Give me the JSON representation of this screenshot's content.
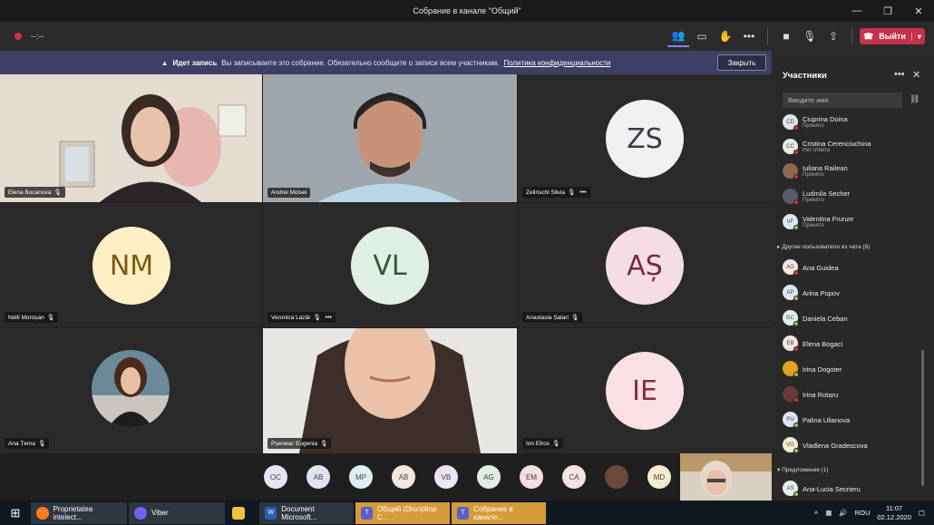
{
  "window": {
    "title": "Собрание в канале \"Общий\""
  },
  "toolbar": {
    "timer": "--:--",
    "leave_label": "Выйти"
  },
  "notice": {
    "title": "Идет запись",
    "text": "Вы записываете это собрание. Обязательно сообщите о записи всем участникам.",
    "link": "Политика конфиденциальности",
    "close_label": "Закрыть"
  },
  "tiles": [
    {
      "name": "Elena Bocancea",
      "type": "video"
    },
    {
      "name": "Andrei Moisei",
      "type": "video"
    },
    {
      "name": "Zelinschi Silvia",
      "type": "avatar",
      "initials": "ZS",
      "color": "#f2eff0",
      "text_color": "#3a3a4a"
    },
    {
      "name": "Nelli Moroșan",
      "type": "avatar",
      "initials": "NM",
      "color": "#fdf0c4",
      "text_color": "#7a5a10"
    },
    {
      "name": "Veronica Lazăr",
      "type": "avatar",
      "initials": "VL",
      "color": "#e0efe3",
      "text_color": "#2d5a36"
    },
    {
      "name": "Anastasia Șalari",
      "type": "avatar",
      "initials": "AȘ",
      "color": "#f5dde6",
      "text_color": "#7a2a40"
    },
    {
      "name": "Ana Țema",
      "type": "photo"
    },
    {
      "name": "Pșeneac Eugenia",
      "type": "video"
    },
    {
      "name": "Ion Efros",
      "type": "avatar",
      "initials": "IE",
      "color": "#f9e0e4",
      "text_color": "#8a2a38"
    }
  ],
  "strip": [
    {
      "initials": "OC",
      "color": "#e6e4f4"
    },
    {
      "initials": "AB",
      "color": "#dfe3ee"
    },
    {
      "initials": "MP",
      "color": "#dceff3"
    },
    {
      "initials": "AB",
      "color": "#f3e7de"
    },
    {
      "initials": "VB",
      "color": "#ece4f2"
    },
    {
      "initials": "AG",
      "color": "#e0ede3"
    },
    {
      "initials": "EM",
      "color": "#f4dede"
    },
    {
      "initials": "CA",
      "color": "#f4e3e0"
    },
    {
      "initials": "",
      "color": "#6a4a3a"
    },
    {
      "initials": "MD",
      "color": "#f7ead2"
    }
  ],
  "panel": {
    "title": "Участники",
    "search_placeholder": "Введите имя",
    "members": [
      {
        "initials": "CD",
        "name": "Ciuprina Doina",
        "sub": "Принято",
        "color": "#dfe3ee",
        "status": "#d13438"
      },
      {
        "initials": "CC",
        "name": "Cristina Cerenciuchina",
        "sub": "Нет ответа",
        "color": "#e6ece0",
        "status": "#d13438"
      },
      {
        "initials": "IR",
        "name": "Iuliana Railean",
        "sub": "Принято",
        "color": "#8a6a50",
        "status": "#d13438"
      },
      {
        "initials": "LS",
        "name": "Ludmila Secher",
        "sub": "Принято",
        "color": "#5a5a6a",
        "status": "#d13438"
      },
      {
        "initials": "VF",
        "name": "Valentina Frunze",
        "sub": "Принято",
        "color": "#dce6f3",
        "status": "#92c353"
      }
    ],
    "section_chat": "Другие пользователи из чата (8)",
    "chat_members": [
      {
        "initials": "AG",
        "name": "Ana Guidea",
        "color": "#f3e7de",
        "status": "#d13438"
      },
      {
        "initials": "AP",
        "name": "Arina Popov",
        "color": "#dce6f3",
        "status": "#92c353"
      },
      {
        "initials": "DC",
        "name": "Daniela Ceban",
        "color": "#dff0ec",
        "status": "#92c353"
      },
      {
        "initials": "EB",
        "name": "Elena Bogaci",
        "color": "#f4e3e0",
        "status": "#d13438"
      },
      {
        "initials": "ID",
        "name": "Irina Dogoter",
        "color": "#e0a020",
        "status": "#92c353"
      },
      {
        "initials": "IR",
        "name": "Irina Rotaru",
        "color": "#6a3a3a",
        "status": "#d13438"
      },
      {
        "initials": "PU",
        "name": "Palina Ulianova",
        "color": "#dce3f3",
        "status": "#92c353"
      },
      {
        "initials": "VG",
        "name": "Vladlena Gradescova",
        "color": "#f7ead2",
        "status": "#92c353"
      }
    ],
    "section_suggest": "Предложения (1)",
    "suggest_members": [
      {
        "initials": "AS",
        "name": "Ana-Lucia Secrieru",
        "color": "#e3ece6",
        "status": "#92c353"
      }
    ]
  },
  "taskbar": {
    "apps": [
      {
        "label": "Proprietatea intelect...",
        "icon_color": "#ff7a20",
        "active": false
      },
      {
        "label": "Viber",
        "icon_color": "#7360f2",
        "active": false
      },
      {
        "label": "",
        "icon_color": "#f0c040",
        "active": false
      },
      {
        "label": "Document Microsoft...",
        "icon_color": "#2b5fb4",
        "active": false
      },
      {
        "label": "Общий (Disciplina C...",
        "icon_color": "#5b5fc7",
        "active": true
      },
      {
        "label": "Собрание в канале...",
        "icon_color": "#5b5fc7",
        "active": true
      }
    ],
    "lang": "ROU",
    "time": "11:07",
    "date": "02.12.2020"
  }
}
